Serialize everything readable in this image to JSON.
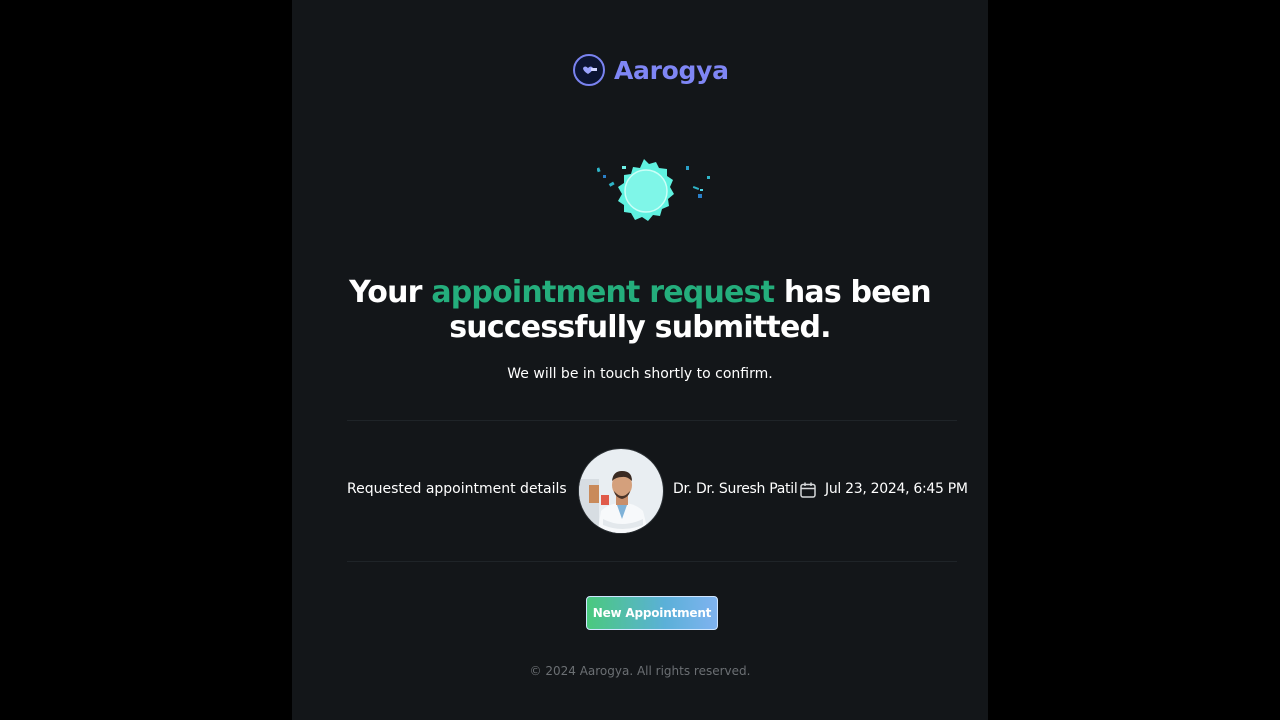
{
  "brand": {
    "name": "Aarogya",
    "color": "#7f86f5"
  },
  "hero": {
    "icon": "success-badge-icon",
    "title_before": "Your ",
    "title_highlight": "appointment request",
    "title_after": " has been successfully submitted.",
    "highlight_color": "#24ae7c",
    "subtitle": "We will be in touch shortly to confirm."
  },
  "details": {
    "label": "Requested appointment details",
    "doctor_name": "Dr. Dr. Suresh Patil",
    "datetime": "Jul 23, 2024, 6:45 PM",
    "calendar_icon": "calendar-icon"
  },
  "actions": {
    "new_appointment_label": "New Appointment"
  },
  "footer": {
    "copyright": "© 2024 Aarogya. All rights reserved."
  }
}
